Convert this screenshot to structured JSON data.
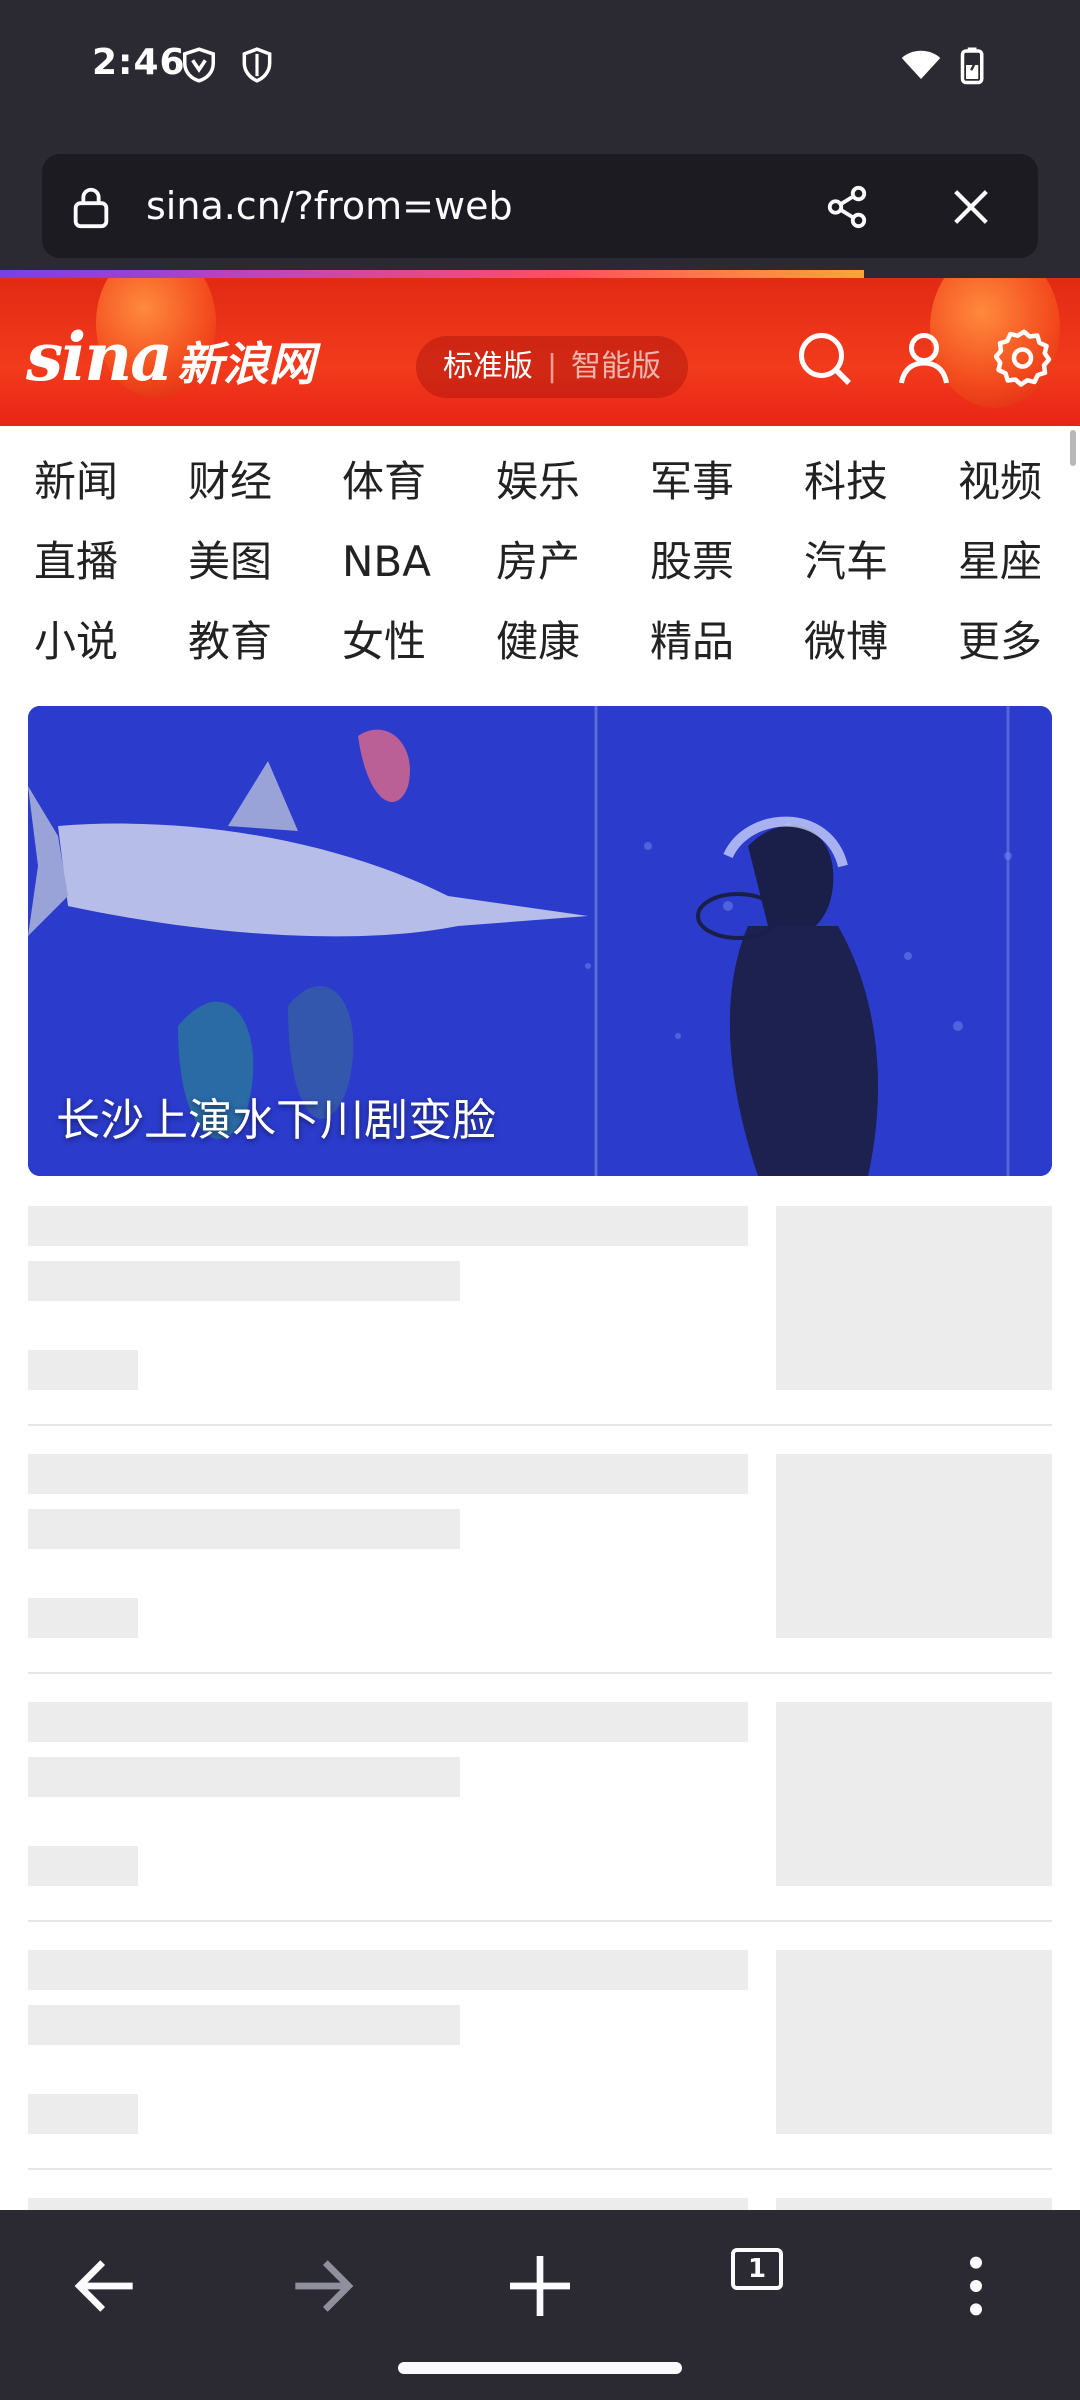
{
  "status_bar": {
    "time": "2:46",
    "icons": [
      "vpn-icon",
      "shield-icon",
      "wifi-icon",
      "battery-icon"
    ]
  },
  "url_bar": {
    "url": "sina.cn/?from=web",
    "icons": [
      "lock-icon",
      "share-icon",
      "close-icon"
    ]
  },
  "page_load_progress": 0.8,
  "sina_header": {
    "brand": "sina",
    "brand_cn": "新浪网",
    "version_active": "标准版",
    "version_separator": "|",
    "version_inactive": "智能版",
    "icons": [
      "search-icon",
      "user-icon",
      "settings-icon"
    ]
  },
  "nav": {
    "items": [
      "新闻",
      "财经",
      "体育",
      "娱乐",
      "军事",
      "科技",
      "视频",
      "直播",
      "美图",
      "NBA",
      "房产",
      "股票",
      "汽车",
      "星座",
      "小说",
      "教育",
      "女性",
      "健康",
      "精品",
      "微博",
      "更多"
    ]
  },
  "hero": {
    "caption": "长沙上演水下川剧变脸"
  },
  "toolbar": {
    "tab_count": "1",
    "icons": [
      "back-icon",
      "forward-icon",
      "new-tab-icon",
      "tabs-icon",
      "menu-icon"
    ]
  },
  "colors": {
    "chrome_bg": "#2b2a33",
    "url_bar_bg": "#1c1b22",
    "sina_red": "#e8261a",
    "skeleton": "#ececec"
  }
}
